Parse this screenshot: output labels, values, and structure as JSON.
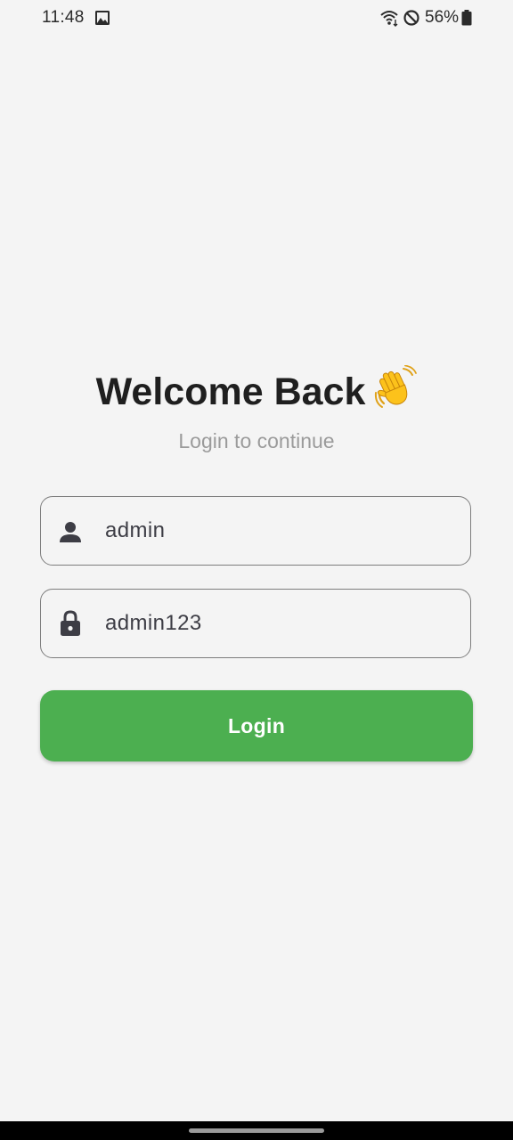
{
  "status_bar": {
    "time": "11:48",
    "battery_percent": "56%",
    "icons": [
      "gallery-icon",
      "wifi-icon",
      "do-not-disturb-icon",
      "battery-icon"
    ]
  },
  "login": {
    "title": "Welcome Back",
    "title_emoji": "waving-hand-icon",
    "subtitle": "Login to continue",
    "username": {
      "value": "admin",
      "icon": "person-icon"
    },
    "password": {
      "value": "admin123",
      "icon": "lock-icon"
    },
    "submit_label": "Login"
  },
  "colors": {
    "background": "#f4f4f4",
    "accent": "#4caf50",
    "title": "#1f1f1f",
    "subtitle": "#9b9b9b",
    "field_border": "#7d7d7d"
  }
}
